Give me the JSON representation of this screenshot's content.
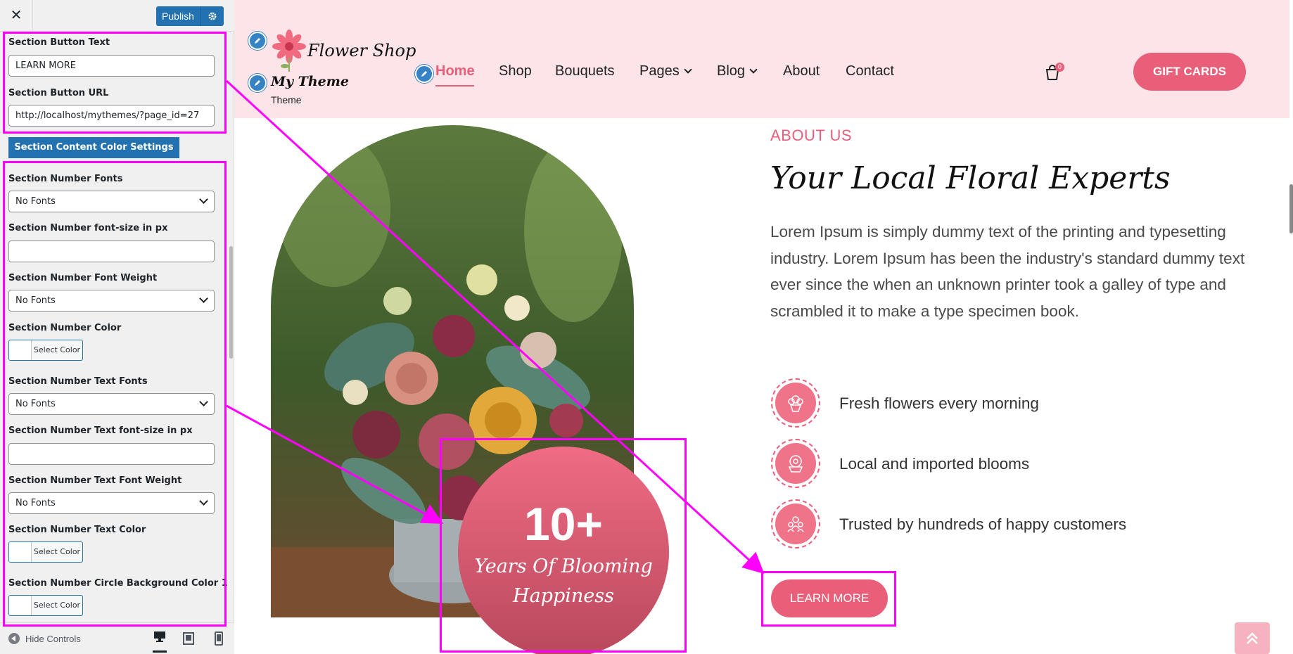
{
  "panel": {
    "close_icon": "close-icon",
    "publish_label": "Publish",
    "section_button_text_label": "Section Button Text",
    "section_button_text_value": "LEARN MORE",
    "section_button_url_label": "Section Button URL",
    "section_button_url_value": "http://localhost/mythemes/?page_id=27",
    "color_settings_button": "Section Content Color Settings",
    "number_fonts_label": "Section Number Fonts",
    "number_fonts_value": "No Fonts",
    "number_font_size_label": "Section Number font-size in px",
    "number_font_size_value": "",
    "number_font_weight_label": "Section Number Font Weight",
    "number_font_weight_value": "No Fonts",
    "number_color_label": "Section Number Color",
    "select_color": "Select Color",
    "number_text_fonts_label": "Section Number Text Fonts",
    "number_text_fonts_value": "No Fonts",
    "number_text_font_size_label": "Section Number Text font-size in px",
    "number_text_font_size_value": "",
    "number_text_font_weight_label": "Section Number Text Font Weight",
    "number_text_font_weight_value": "No Fonts",
    "number_text_color_label": "Section Number Text Color",
    "circle_bg_color_label": "Section Number Circle Background Color 1",
    "hide_controls": "Hide Controls"
  },
  "site": {
    "logo_title": "Flower Shop",
    "site_name": "My Theme",
    "tagline": "Theme",
    "nav": [
      "Home",
      "Shop",
      "Bouquets",
      "Pages",
      "Blog",
      "About",
      "Contact"
    ],
    "cart_count": "0",
    "gift_cards": "GIFT CARDS"
  },
  "about": {
    "label": "ABOUT US",
    "heading": "Your Local Floral Experts",
    "paragraph": "Lorem Ipsum is simply dummy text of the printing and typesetting industry. Lorem Ipsum has been the industry's standard dummy text ever since the when an unknown printer took a galley of type and scrambled it to make a type specimen book.",
    "features": [
      "Fresh flowers every morning",
      "Local and imported blooms",
      "Trusted by hundreds of happy customers"
    ],
    "button": "LEARN MORE",
    "circle_number": "10+",
    "circle_text": "Years Of Blooming Happiness"
  },
  "colors": {
    "accent": "#e95f7a",
    "header_bg": "#fce4e8",
    "wp_blue": "#2271b1",
    "annotation": "#ff00ff"
  }
}
